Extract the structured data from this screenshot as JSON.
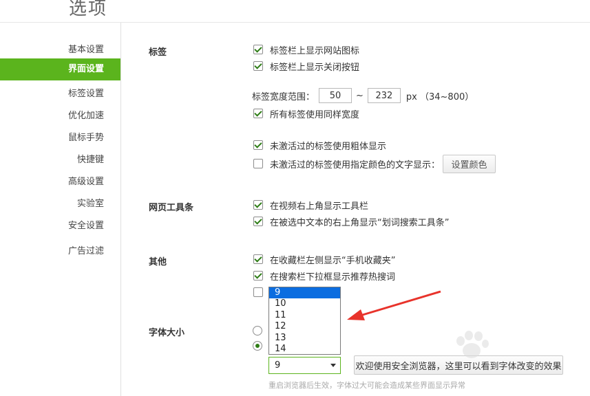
{
  "page_title": "选项",
  "sidebar": {
    "items": [
      {
        "label": "基本设置"
      },
      {
        "label": "界面设置",
        "active": true
      },
      {
        "label": "标签设置"
      },
      {
        "label": "优化加速"
      },
      {
        "label": "鼠标手势"
      },
      {
        "label": "快捷键"
      },
      {
        "label": "高级设置"
      },
      {
        "label": "实验室"
      },
      {
        "label": "安全设置"
      },
      {
        "label": "广告过滤"
      }
    ]
  },
  "sections": {
    "tabs": {
      "label": "标签",
      "show_site_icon": {
        "label": "标签栏上显示网站图标",
        "checked": true
      },
      "show_close_button": {
        "label": "标签栏上显示关闭按钮",
        "checked": true
      },
      "width_range": {
        "label": "标签宽度范围：",
        "min": "50",
        "separator": "~",
        "max": "232",
        "unit": "px （34~800）"
      },
      "same_width": {
        "label": "所有标签使用同样宽度",
        "checked": true
      },
      "bold_unactivated": {
        "label": "未激活过的标签使用粗体显示",
        "checked": true
      },
      "color_unactivated": {
        "label": "未激活过的标签使用指定颜色的文字显示：",
        "checked": false
      },
      "set_color_button": "设置颜色"
    },
    "toolbar": {
      "label": "网页工具条",
      "video_toolbar": {
        "label": "在视频右上角显示工具栏",
        "checked": true
      },
      "selection_search": {
        "label": "在被选中文本的右上角显示“划词搜索工具条”",
        "checked": true
      }
    },
    "other": {
      "label": "其他",
      "mobile_favorites": {
        "label": "在收藏栏左侧显示“手机收藏夹”",
        "checked": true
      },
      "hot_words": {
        "label": "在搜索栏下拉框显示推荐热搜词",
        "checked": true
      },
      "hidden_option_checked": false
    },
    "font_size": {
      "label": "字体大小",
      "radio_1_checked": false,
      "radio_2_checked": true,
      "options": [
        "9",
        "10",
        "11",
        "12",
        "13",
        "14"
      ],
      "selected": "9",
      "preview_button": "欢迎使用安全浏览器，这里可以看到字体改变的效果",
      "hint": "重启浏览器后生效，字体过大可能会造成某些界面显示异常"
    }
  },
  "colors": {
    "accent": "#5bb41d",
    "arrow": "#e8332b",
    "selection": "#0b6de0"
  }
}
